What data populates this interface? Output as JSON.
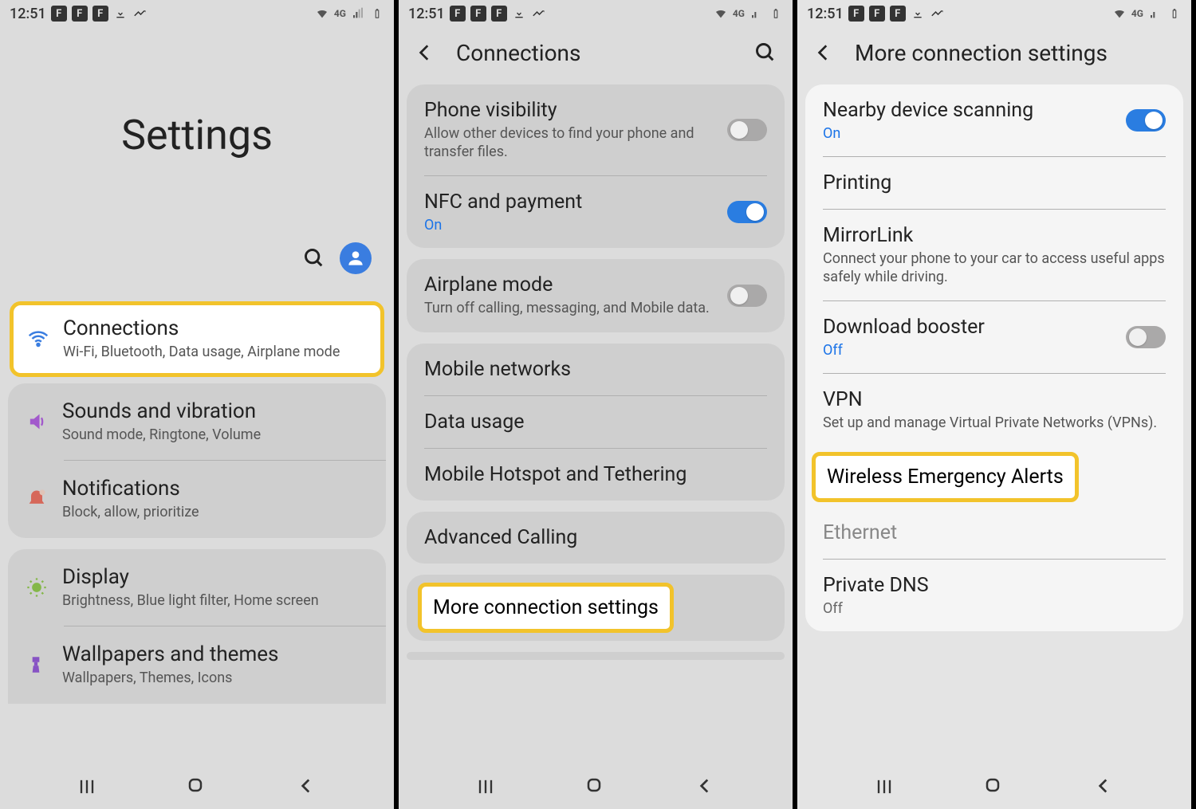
{
  "status": {
    "time": "12:51"
  },
  "screen1": {
    "title": "Settings",
    "items": [
      {
        "title": "Connections",
        "sub": "Wi-Fi, Bluetooth, Data usage, Airplane mode"
      },
      {
        "title": "Sounds and vibration",
        "sub": "Sound mode, Ringtone, Volume"
      },
      {
        "title": "Notifications",
        "sub": "Block, allow, prioritize"
      },
      {
        "title": "Display",
        "sub": "Brightness, Blue light filter, Home screen"
      },
      {
        "title": "Wallpapers and themes",
        "sub": "Wallpapers, Themes, Icons"
      }
    ]
  },
  "screen2": {
    "title": "Connections",
    "items": {
      "phone_visibility": {
        "title": "Phone visibility",
        "sub": "Allow other devices to find your phone and transfer files."
      },
      "nfc": {
        "title": "NFC and payment",
        "status": "On"
      },
      "airplane": {
        "title": "Airplane mode",
        "sub": "Turn off calling, messaging, and Mobile data."
      },
      "mobile_networks": {
        "title": "Mobile networks"
      },
      "data_usage": {
        "title": "Data usage"
      },
      "hotspot": {
        "title": "Mobile Hotspot and Tethering"
      },
      "advanced_calling": {
        "title": "Advanced Calling"
      },
      "more": {
        "title": "More connection settings"
      }
    }
  },
  "screen3": {
    "title": "More connection settings",
    "items": {
      "nearby": {
        "title": "Nearby device scanning",
        "status": "On"
      },
      "printing": {
        "title": "Printing"
      },
      "mirrorlink": {
        "title": "MirrorLink",
        "sub": "Connect your phone to your car to access useful apps safely while driving."
      },
      "download_booster": {
        "title": "Download booster",
        "status": "Off"
      },
      "vpn": {
        "title": "VPN",
        "sub": "Set up and manage Virtual Private Networks (VPNs)."
      },
      "wea": {
        "title": "Wireless Emergency Alerts"
      },
      "ethernet": {
        "title": "Ethernet"
      },
      "private_dns": {
        "title": "Private DNS",
        "status": "Off"
      }
    }
  }
}
